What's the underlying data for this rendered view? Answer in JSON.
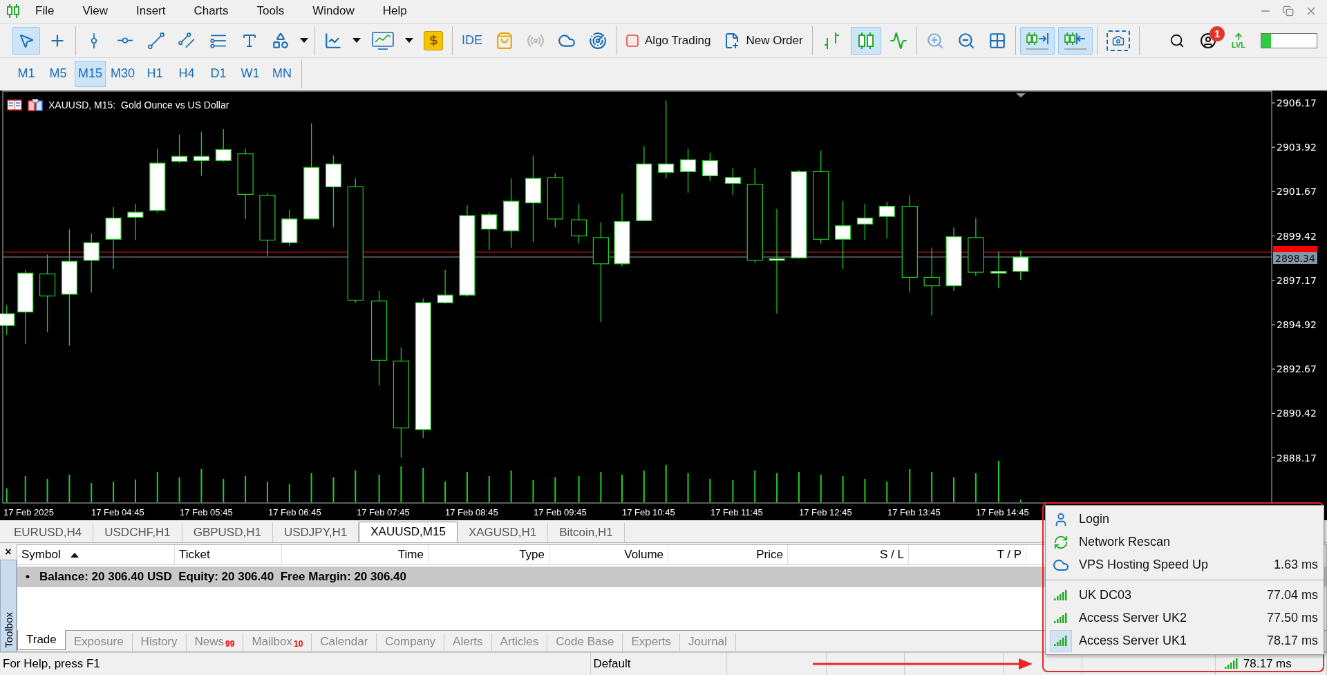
{
  "menu_bar": {
    "items": [
      "File",
      "View",
      "Insert",
      "Charts",
      "Tools",
      "Window",
      "Help"
    ]
  },
  "toolbar": {
    "groups": [
      [
        {
          "kind": "cursor",
          "selected": true,
          "disabled": false
        },
        {
          "kind": "crosshair",
          "selected": false,
          "disabled": false
        }
      ],
      [
        {
          "kind": "vline",
          "selected": false,
          "disabled": false
        },
        {
          "kind": "hline",
          "selected": false,
          "disabled": false
        },
        {
          "kind": "trendline",
          "selected": false,
          "disabled": false
        },
        {
          "kind": "channel",
          "selected": false,
          "disabled": false
        },
        {
          "kind": "fibo",
          "selected": false,
          "disabled": false
        },
        {
          "kind": "text",
          "selected": false,
          "disabled": false
        },
        {
          "kind": "shapes",
          "selected": false,
          "disabled": false
        },
        {
          "kind": "dropdown",
          "selected": false,
          "disabled": false
        }
      ],
      [
        {
          "kind": "linechart",
          "selected": false,
          "disabled": false
        },
        {
          "kind": "dropdown",
          "selected": false,
          "disabled": false
        },
        {
          "kind": "indicators",
          "selected": false,
          "disabled": false
        },
        {
          "kind": "dropdown",
          "selected": false,
          "disabled": false
        },
        {
          "kind": "dollar",
          "selected": false,
          "disabled": false
        }
      ],
      [
        {
          "kind": "label",
          "label": "IDE",
          "selected": false,
          "disabled": false
        },
        {
          "kind": "market",
          "selected": false,
          "disabled": false
        },
        {
          "kind": "signals",
          "selected": false,
          "disabled": true
        },
        {
          "kind": "vps",
          "selected": false,
          "disabled": false
        },
        {
          "kind": "radar",
          "selected": false,
          "disabled": false
        }
      ],
      [
        {
          "kind": "algo",
          "label": "Algo Trading",
          "selected": false,
          "disabled": false
        },
        {
          "kind": "order",
          "label": "New Order",
          "selected": false,
          "disabled": false
        }
      ],
      [
        {
          "kind": "bars",
          "selected": false,
          "disabled": false
        },
        {
          "kind": "candles",
          "selected": true,
          "disabled": false
        },
        {
          "kind": "line",
          "selected": false,
          "disabled": false
        }
      ],
      [
        {
          "kind": "zoomin",
          "selected": false,
          "disabled": true
        },
        {
          "kind": "zoomout",
          "selected": false,
          "disabled": false
        },
        {
          "kind": "tile",
          "selected": false,
          "disabled": false
        }
      ],
      [
        {
          "kind": "autoscroll",
          "selected": true,
          "disabled": false
        },
        {
          "kind": "shift",
          "selected": true,
          "disabled": false
        }
      ],
      [
        {
          "kind": "screenshot",
          "selected": false,
          "disabled": false
        }
      ]
    ],
    "notifications_badge": "1",
    "level_indicator": {
      "label": "LVL",
      "level": 0.18
    }
  },
  "timeframes": [
    {
      "label": "M1",
      "selected": false
    },
    {
      "label": "M5",
      "selected": false
    },
    {
      "label": "M15",
      "selected": true
    },
    {
      "label": "M30",
      "selected": false
    },
    {
      "label": "H1",
      "selected": false
    },
    {
      "label": "H4",
      "selected": false
    },
    {
      "label": "D1",
      "selected": false
    },
    {
      "label": "W1",
      "selected": false
    },
    {
      "label": "MN",
      "selected": false
    }
  ],
  "chart": {
    "title": "XAUUSD, M15:  Gold Ounce vs US Dollar",
    "price_labels": [
      "2906.17",
      "2903.92",
      "2901.67",
      "2899.42",
      "2897.17",
      "2894.92",
      "2892.67",
      "2890.42",
      "2888.17"
    ],
    "bid_label": "2898.34",
    "time_labels": [
      "17 Feb 2025",
      "17 Feb 04:45",
      "17 Feb 05:45",
      "17 Feb 06:45",
      "17 Feb 07:45",
      "17 Feb 08:45",
      "17 Feb 09:45",
      "17 Feb 10:45",
      "17 Feb 11:45",
      "17 Feb 12:45",
      "17 Feb 13:45",
      "17 Feb 14:45"
    ]
  },
  "chart_tabs": [
    {
      "label": "EURUSD,H4",
      "selected": false
    },
    {
      "label": "USDCHF,H1",
      "selected": false
    },
    {
      "label": "GBPUSD,H1",
      "selected": false
    },
    {
      "label": "USDJPY,H1",
      "selected": false
    },
    {
      "label": "XAUUSD,M15",
      "selected": true
    },
    {
      "label": "XAGUSD,H1",
      "selected": false
    },
    {
      "label": "Bitcoin,H1",
      "selected": false
    }
  ],
  "toolbox": {
    "title": "Toolbox",
    "close": "×",
    "columns": [
      "Symbol",
      "Ticket",
      "Time",
      "Type",
      "Volume",
      "Price",
      "S / L",
      "T / P"
    ],
    "balance_row": {
      "bullet": "•",
      "text": "Balance: 20 306.40 USD  Equity: 20 306.40  Free Margin: 20 306.40"
    },
    "tabs": [
      {
        "label": "Trade",
        "selected": true
      },
      {
        "label": "Exposure",
        "selected": false
      },
      {
        "label": "History",
        "selected": false
      },
      {
        "label": "News",
        "badge": "99",
        "selected": false
      },
      {
        "label": "Mailbox",
        "badge": "10",
        "selected": false
      },
      {
        "label": "Calendar",
        "selected": false
      },
      {
        "label": "Company",
        "selected": false
      },
      {
        "label": "Alerts",
        "selected": false
      },
      {
        "label": "Articles",
        "selected": false
      },
      {
        "label": "Code Base",
        "selected": false
      },
      {
        "label": "Experts",
        "selected": false
      },
      {
        "label": "Journal",
        "selected": false
      }
    ]
  },
  "status_bar": {
    "help": "For Help, press F1",
    "profile": "Default",
    "ping": "78.17 ms"
  },
  "connection_menu": {
    "items": [
      {
        "kind": "login",
        "label": "Login",
        "selected": false
      },
      {
        "kind": "rescan",
        "label": "Network Rescan",
        "selected": false
      },
      {
        "kind": "vps",
        "label": "VPS Hosting Speed Up",
        "ping": "1.63 ms",
        "selected": false
      },
      {
        "kind": "separator"
      },
      {
        "kind": "server",
        "label": "UK DC03",
        "ping": "77.04 ms",
        "selected": false
      },
      {
        "kind": "server",
        "label": "Access Server UK2",
        "ping": "77.50 ms",
        "selected": false
      },
      {
        "kind": "server",
        "label": "Access Server UK1",
        "ping": "78.17 ms",
        "selected": true
      }
    ]
  }
}
